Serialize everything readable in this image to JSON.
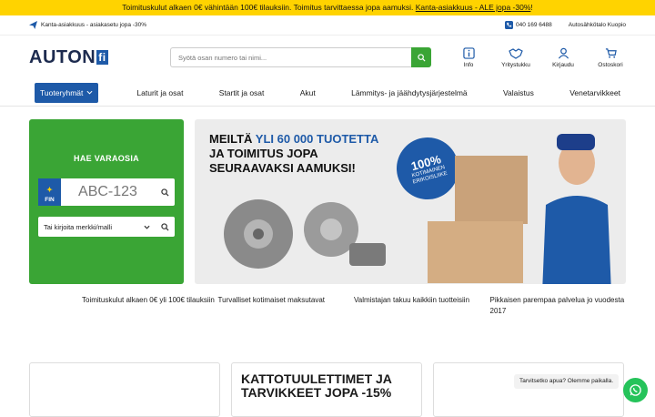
{
  "topbar": {
    "text": "Toimituskulut alkaen 0€ vähintään 100€ tilauksiin. Toimitus tarvittaessa jopa aamuksi. ",
    "link": "Kanta-asiakkuus - ALE jopa -30%",
    "tail": "!"
  },
  "subbar": {
    "promo": "Kanta-asiakkuus - asiakasetu jopa -30%",
    "phone": "040 169 6488",
    "store": "Autosähkötalo Kuopio"
  },
  "logo": {
    "text": "AUTON",
    "suffix": "fi"
  },
  "search": {
    "placeholder": "Syötä osan numero tai nimi..."
  },
  "header_icons": [
    {
      "label": "Info"
    },
    {
      "label": "Yritystukku"
    },
    {
      "label": "Kirjaudu"
    },
    {
      "label": "Ostoskori"
    }
  ],
  "nav": {
    "category_button": "Tuoteryhmät",
    "items": [
      "Laturit ja osat",
      "Startit ja osat",
      "Akut",
      "Lämmitys- ja jäähdytysjärjestelmä",
      "Valaistus",
      "Venetarvikkeet"
    ]
  },
  "parts_search": {
    "title": "HAE VARAOSIA",
    "country": "FIN",
    "plate_placeholder": "ABC-123",
    "model_select": "Tai kirjoita merkki/malli"
  },
  "banner": {
    "line1a": "MEILTÄ ",
    "line1b": "YLI 60 000 TUOTETTA",
    "line2": "JA TOIMITUS JOPA",
    "line3": "SEURAAVAKSI AAMUKSI!",
    "badge_pct": "100%",
    "badge_text": "KOTIMAINEN ERIKOISLIIKE"
  },
  "features": [
    "Toimituskulut alkaen 0€ yli 100€ tilauksiin",
    "Turvalliset kotimaiset maksutavat",
    "Valmistajan takuu kaikkiin tuotteisiin",
    "Pikkaisen parempaa palvelua jo vuodesta 2017"
  ],
  "cards": {
    "middle_title": "KATTOTUULETTIMET JA TARVIKKEET JOPA -15%"
  },
  "chat": {
    "text": "Tarvitsetko apua? Olemme paikalla."
  },
  "colors": {
    "accent_yellow": "#ffd300",
    "brand_blue": "#1e5aa8",
    "brand_green": "#3aa535"
  }
}
